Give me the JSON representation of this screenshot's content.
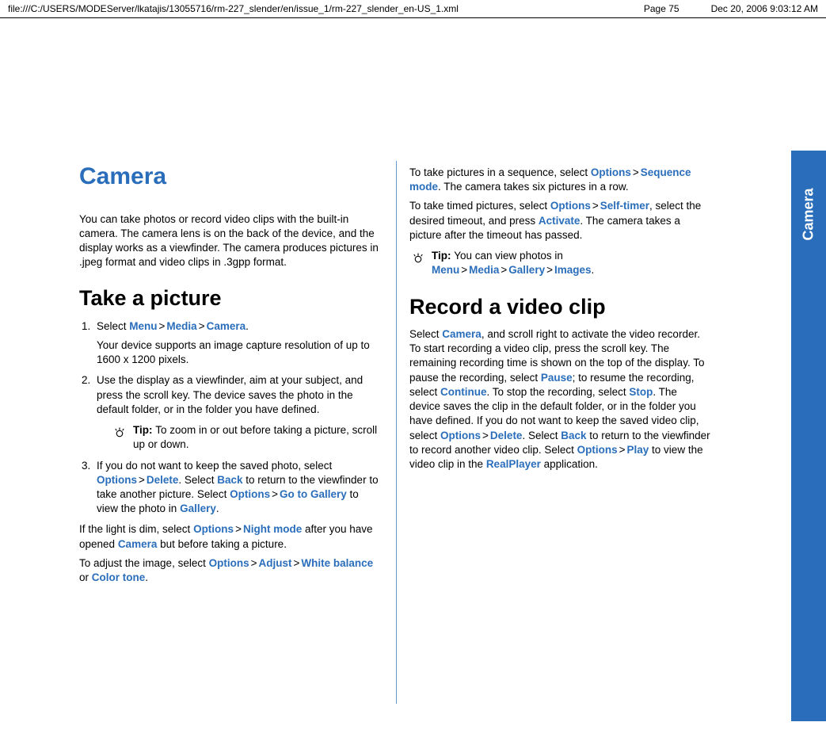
{
  "header": {
    "path": "file:///C:/USERS/MODEServer/lkatajis/13055716/rm-227_slender/en/issue_1/rm-227_slender_en-US_1.xml",
    "page": "Page 75",
    "date": "Dec 20, 2006 9:03:12 AM"
  },
  "side": {
    "label": "Camera",
    "page_number": "75"
  },
  "title": "Camera",
  "intro": "You can take photos or record video clips with the built-in camera. The camera lens is on the back of the device, and the display works as a viewfinder. The camera produces pictures in .jpeg format and video clips in .3gpp format.",
  "take_picture": {
    "heading": "Take a picture",
    "step1_pre": "Select ",
    "menu": "Menu",
    "media": "Media",
    "camera": "Camera",
    "step1_post": ".",
    "step1_body": "Your device supports an image capture resolution of up to 1600 x 1200 pixels.",
    "step2": "Use the display as a viewfinder, aim at your subject, and press the scroll key. The device saves the photo in the default folder, or in the folder you have defined.",
    "tip1_label": "Tip:  ",
    "tip1_text": "To zoom in or out before taking a picture, scroll up or down.",
    "step3_a": "If you do not want to keep the saved photo, select ",
    "options": "Options",
    "delete": "Delete",
    "step3_b": ". Select ",
    "back": "Back",
    "step3_c": " to return to the viewfinder to take another picture. Select ",
    "go_gallery": "Go to Gallery",
    "step3_d": " to view the photo in ",
    "gallery": "Gallery",
    "step3_e": ".",
    "night_a": "If the light is dim, select ",
    "night_mode": "Night mode",
    "night_b": " after you have opened ",
    "night_c": " but before taking a picture.",
    "adjust_a": "To adjust the image, select ",
    "adjust": "Adjust",
    "white_balance": "White balance",
    "color_tone": "Color tone",
    "or": " or "
  },
  "right": {
    "seq_a": "To take pictures in a sequence, select ",
    "sequence_mode": "Sequence mode",
    "seq_b": ". The camera takes six pictures in a row.",
    "timer_a": "To take timed pictures, select ",
    "self_timer": "Self-timer",
    "timer_b": ", select the desired timeout, and press ",
    "activate": "Activate",
    "timer_c": ". The camera takes a picture after the timeout has passed.",
    "tip2_label": "Tip: ",
    "tip2_a": "You can view photos in ",
    "images": "Images",
    "record_heading": "Record a video clip",
    "rec_a": "Select ",
    "rec_b": ", and scroll right to activate the video recorder. To start recording a video clip, press the scroll key. The remaining recording time is shown on the top of the display. To pause the recording, select ",
    "pause": "Pause",
    "rec_c": "; to resume the recording, select ",
    "continue": "Continue",
    "rec_d": ". To stop the recording, select ",
    "stop": "Stop",
    "rec_e": ". The device saves the clip in the default folder, or in the folder you have defined. If you do not want to keep the saved video clip, select ",
    "rec_f": ". Select ",
    "rec_g": " to return to the viewfinder to record another video clip. Select ",
    "play": "Play",
    "rec_h": " to view the video clip in the ",
    "realplayer": "RealPlayer",
    "rec_i": " application."
  },
  "gt": ">"
}
